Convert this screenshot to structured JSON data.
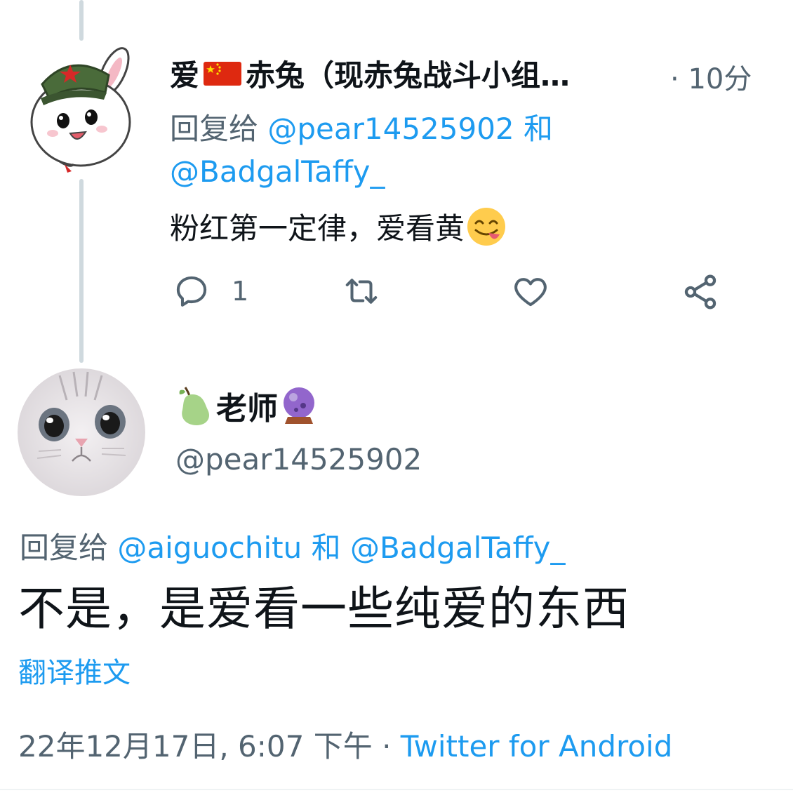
{
  "reply_tweet": {
    "display_name": "爱",
    "flag_icon": "china-flag-icon",
    "display_name_rest": "赤兔（现赤兔战斗小组…",
    "separator": "·",
    "time": "10分",
    "reply_prefix": "回复给",
    "reply_to_1": "@pear14525902",
    "reply_and": "和",
    "reply_to_2": "@BadgalTaffy_",
    "text": "粉红第一定律，爱看黄",
    "emoji_icon": "face-savoring-food-emoji",
    "actions": {
      "reply_icon": "comment-icon",
      "reply_count": "1",
      "retweet_icon": "retweet-icon",
      "like_icon": "heart-icon",
      "share_icon": "share-icon"
    }
  },
  "main_tweet": {
    "pear_icon": "pear-emoji",
    "display_name": "老师",
    "crystal_ball_icon": "crystal-ball-emoji",
    "handle": "@pear14525902",
    "reply_prefix": "回复给",
    "reply_to_1": "@aiguochitu",
    "reply_and": "和",
    "reply_to_2": "@BadgalTaffy_",
    "text": "不是，是爱看一些纯爱的东西",
    "translate_label": "翻译推文",
    "timestamp": "22年12月17日, 6:07 下午",
    "meta_separator": "·",
    "source": "Twitter for Android"
  },
  "colors": {
    "text": "#0f1419",
    "muted": "#536471",
    "link": "#1d9bf0",
    "thread_line": "#cfd9de"
  }
}
